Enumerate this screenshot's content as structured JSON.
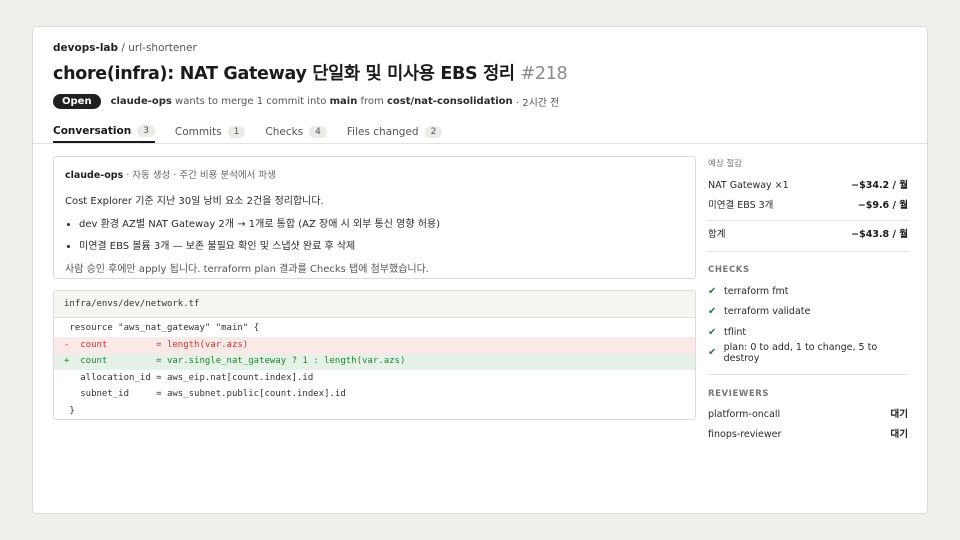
{
  "header": {
    "owner": "devops-lab",
    "repo": "url-shortener",
    "title": "chore(infra): NAT Gateway 단일화 및 미사용 EBS 정리",
    "number": "#218",
    "state": "Open",
    "author": "claude-ops",
    "merge_text": "wants to merge 1 commit into",
    "base_branch": "main",
    "from_text": "from",
    "head_branch": "cost/nat-consolidation",
    "time": "· 2시간 전"
  },
  "tabs": [
    {
      "label": "Conversation",
      "count": "3"
    },
    {
      "label": "Commits",
      "count": "1"
    },
    {
      "label": "Checks",
      "count": "4"
    },
    {
      "label": "Files changed",
      "count": "2"
    }
  ],
  "comment": {
    "author": "claude-ops",
    "meta": "· 자동 생성 · 주간 비용 분석에서 파생",
    "summary": "Cost Explorer 기준 지난 30일 낭비 요소 2건을 정리합니다.",
    "bullets": [
      "dev 환경 AZ별 NAT Gateway 2개 → 1개로 통합 (AZ 장애 시 외부 통신 영향 허용)",
      "미연결 EBS 볼륨 3개 — 보존 불필요 확인 및 스냅샷 완료 후 삭제"
    ],
    "footer": "사람 승인 후에만 apply 됩니다. terraform plan 결과를 Checks 탭에 첨부했습니다."
  },
  "diff": {
    "filename": "infra/envs/dev/network.tf",
    "lines": [
      " resource \"aws_nat_gateway\" \"main\" {",
      "-  count         = length(var.azs)",
      "+  count         = var.single_nat_gateway ? 1 : length(var.azs)",
      "   allocation_id = aws_eip.nat[count.index].id",
      "   subnet_id     = aws_subnet.public[count.index].id",
      " }"
    ]
  },
  "savings": {
    "heading": "예상 절감",
    "items": [
      {
        "label": "NAT Gateway ×1",
        "value": "−$34.2 / 월"
      },
      {
        "label": "미연결 EBS 3개",
        "value": "−$9.6 / 월"
      }
    ],
    "total_label": "합계",
    "total_value": "−$43.8 / 월"
  },
  "checks": {
    "heading": "CHECKS",
    "items": [
      "terraform fmt",
      "terraform validate",
      "tflint",
      "plan: 0 to add, 1 to change, 5 to destroy"
    ]
  },
  "reviewers": {
    "heading": "REVIEWERS",
    "items": [
      {
        "name": "platform-oncall",
        "status": "대기"
      },
      {
        "name": "finops-reviewer",
        "status": "대기"
      }
    ]
  },
  "colors": {
    "accent": "#1f1f1f",
    "success": "#2c7a3b",
    "deleted": "#b23b32"
  }
}
